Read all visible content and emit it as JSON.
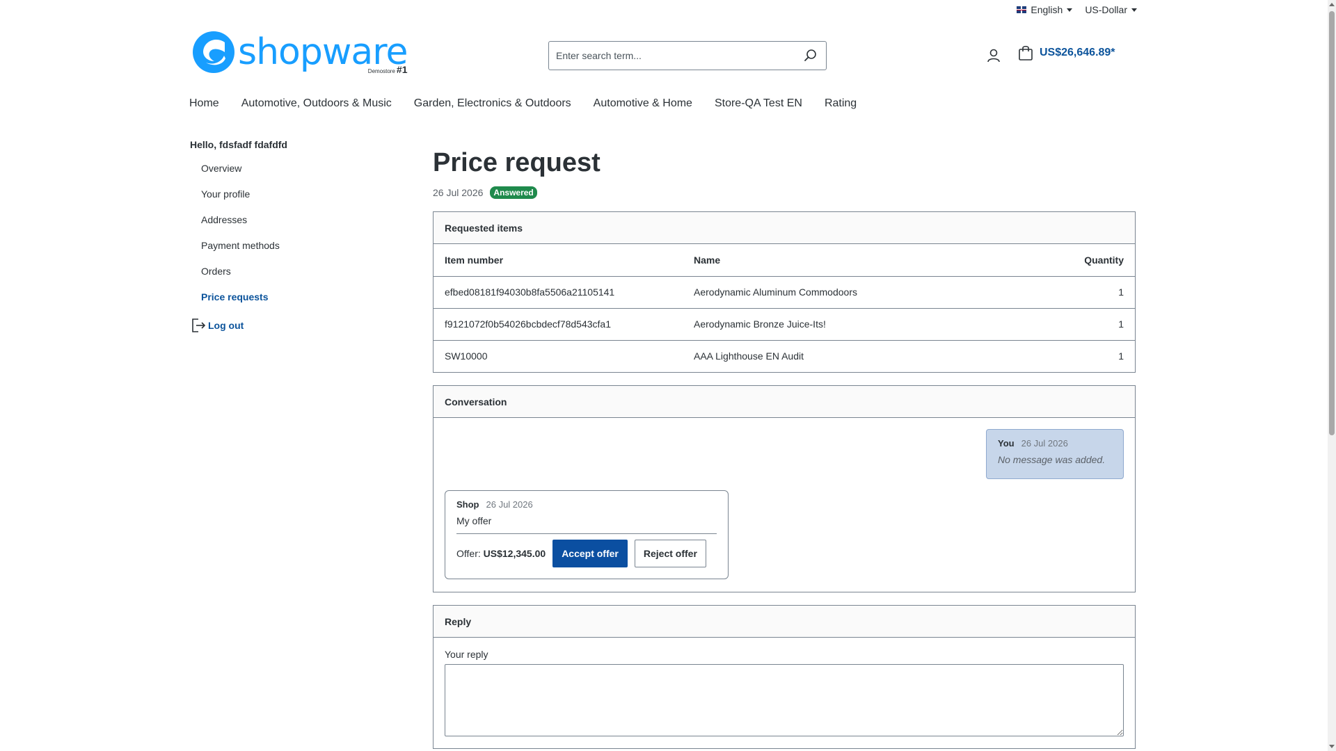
{
  "topbar": {
    "language": "English",
    "currency": "US-Dollar"
  },
  "header": {
    "logo_text": "shopware",
    "logo_sub": "Demostore",
    "logo_num": "#1",
    "search_placeholder": "Enter search term...",
    "cart_total": "US$26,646.89*"
  },
  "nav": [
    "Home",
    "Automotive, Outdoors & Music",
    "Garden, Electronics & Outdoors",
    "Automotive & Home",
    "Store-QA Test EN",
    "Rating"
  ],
  "sidebar": {
    "greeting": "Hello, fdsfadf fdafdfd",
    "items": [
      "Overview",
      "Your profile",
      "Addresses",
      "Payment methods",
      "Orders",
      "Price requests"
    ],
    "logout": "Log out"
  },
  "page": {
    "title": "Price request",
    "date": "26 Jul 2026",
    "status": "Answered"
  },
  "items_card": {
    "title": "Requested items",
    "columns": [
      "Item number",
      "Name",
      "Quantity"
    ],
    "rows": [
      {
        "number": "efbed08181f94030b8fa5506a21105141",
        "name": "Aerodynamic Aluminum Commodoors",
        "qty": "1"
      },
      {
        "number": "f9121072f0b54026bcbdecf78d543cfa1",
        "name": "Aerodynamic Bronze Juice-Its!",
        "qty": "1"
      },
      {
        "number": "SW10000",
        "name": "AAA Lighthouse EN Audit",
        "qty": "1"
      }
    ]
  },
  "conversation": {
    "title": "Conversation",
    "you": {
      "author": "You",
      "date": "26 Jul 2026",
      "text": "No message was added."
    },
    "shop": {
      "author": "Shop",
      "date": "26 Jul 2026",
      "text": "My offer",
      "offer_label": "Offer:",
      "offer_value": "US$12,345.00",
      "accept": "Accept offer",
      "reject": "Reject offer"
    }
  },
  "reply": {
    "title": "Reply",
    "label": "Your reply"
  },
  "colors": {
    "brand": "#189eff",
    "primary": "#0b539b",
    "status_answered": "#1f8a4c"
  }
}
